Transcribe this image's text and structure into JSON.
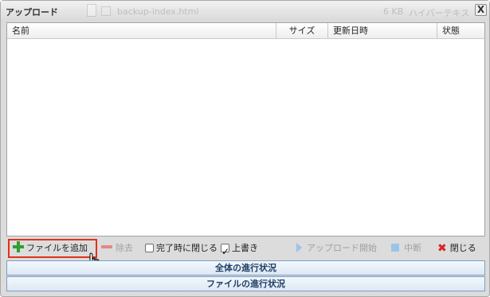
{
  "dialog": {
    "title": "アップロード",
    "close_label": "X",
    "background_file": {
      "name": "backup-index.html",
      "size": "6 KB",
      "type": "ハイパーテキス"
    }
  },
  "grid": {
    "columns": [
      "名前",
      "サイズ",
      "更新日時",
      "状態"
    ],
    "rows": []
  },
  "toolbar": {
    "add_label": "ファイルを追加",
    "remove_label": "除去",
    "close_on_complete_label": "完了時に閉じる",
    "close_on_complete_checked": false,
    "overwrite_label": "上書き",
    "overwrite_checked": true,
    "start_upload_label": "アップロード開始",
    "stop_label": "中断",
    "close_label": "閉じる"
  },
  "progress": {
    "total_label": "全体の進行状況",
    "total_value": 0,
    "file_label": "ファイルの進行状況",
    "file_value": 0
  },
  "colors": {
    "accent": "#e0321a",
    "progress_border": "#7c9ec6",
    "add_icon": "#2ea02e",
    "close_icon": "#d22222"
  }
}
